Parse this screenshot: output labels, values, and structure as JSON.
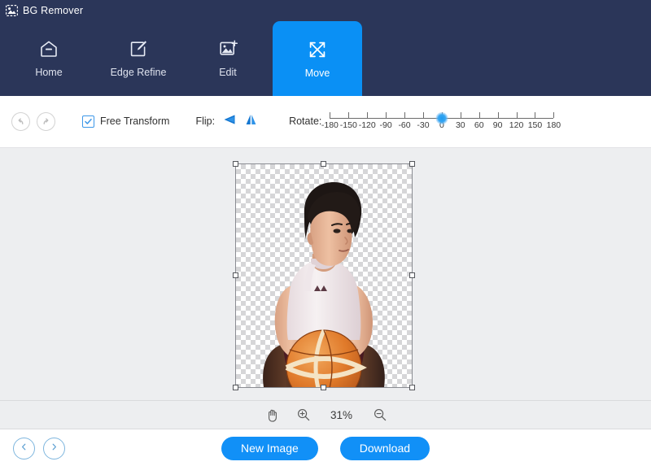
{
  "app": {
    "title": "BG Remover",
    "logo_icon": "image-photo-icon",
    "header_bg": "#2b3659",
    "accent": "#0a90f5"
  },
  "nav": {
    "tabs": [
      {
        "label": "Home",
        "icon": "home-icon",
        "active": false
      },
      {
        "label": "Edge Refine",
        "icon": "pen-edit-icon",
        "active": false
      },
      {
        "label": "Edit",
        "icon": "image-edit-icon",
        "active": false
      },
      {
        "label": "Move",
        "icon": "move-arrows-icon",
        "active": true
      }
    ]
  },
  "toolbar": {
    "undo_icon": "undo-arrow-icon",
    "redo_icon": "redo-arrow-icon",
    "free_transform_label": "Free Transform",
    "free_transform_checked": true,
    "flip_label": "Flip:",
    "flip_horizontal_icon": "flip-horizontal-icon",
    "flip_vertical_icon": "flip-vertical-icon",
    "rotate_label": "Rotate:",
    "rotate_value": 0,
    "rotate_min": -180,
    "rotate_max": 180,
    "rotate_ticks": [
      "-180",
      "-150",
      "-120",
      "-90",
      "-60",
      "-30",
      "0",
      "30",
      "60",
      "90",
      "120",
      "150",
      "180"
    ]
  },
  "canvas": {
    "background": "#edeef0",
    "transparency_checker": true,
    "selection_handles": 8,
    "subject_alt": "basketball-player-cutout"
  },
  "zoombar": {
    "hand_icon": "hand-tool-icon",
    "zoom_in_icon": "zoom-in-icon",
    "zoom_out_icon": "zoom-out-icon",
    "zoom_level": "31%"
  },
  "bottom": {
    "prev_icon": "chevron-left-icon",
    "next_icon": "chevron-right-icon",
    "new_image_label": "New Image",
    "download_label": "Download"
  }
}
